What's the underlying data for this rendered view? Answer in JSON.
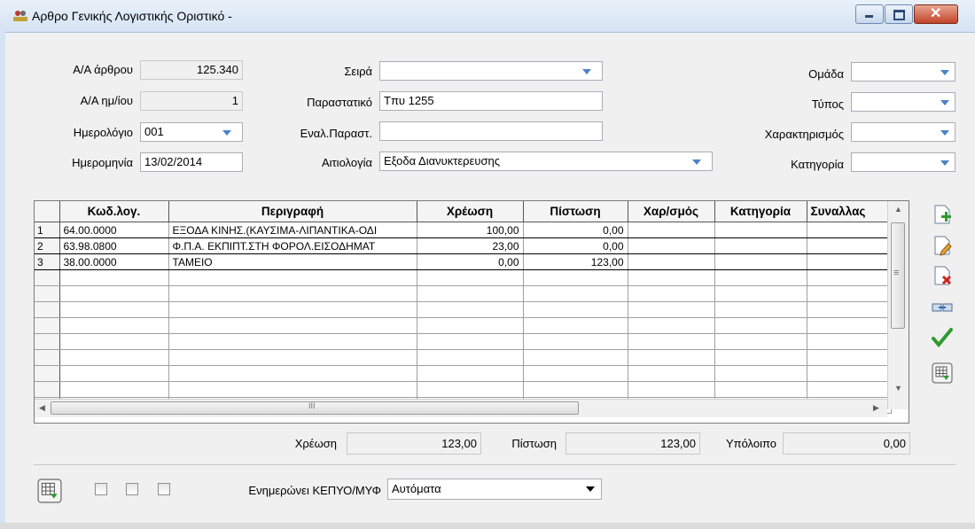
{
  "window": {
    "title": "Αρθρο Γενικής Λογιστικής Οριστικό -"
  },
  "header": {
    "aa_arthrou_label": "Α/Α άρθρου",
    "aa_arthrou_value": "125.340",
    "aa_hmeras_label": "Α/Α ημ/ίου",
    "aa_hmeras_value": "1",
    "journal_label": "Ημερολόγιο",
    "journal_value": "001",
    "date_label": "Ημερομηνία",
    "date_value": "13/02/2014",
    "series_label": "Σειρά",
    "series_value": "",
    "document_label": "Παραστατικό",
    "document_value": "Τπυ 1255",
    "alt_document_label": "Εναλ.Παραστ.",
    "alt_document_value": "",
    "reason_label": "Αιτιολογία",
    "reason_value": "Εξοδα Διανυκτερευσης",
    "group_label": "Ομάδα",
    "group_value": "",
    "type_label": "Τύπος",
    "type_value": "",
    "characterization_label": "Χαρακτηρισμός",
    "characterization_value": "",
    "category_label": "Κατηγορία",
    "category_value": ""
  },
  "grid": {
    "columns": [
      "Κωδ.λογ.",
      "Περιγραφή",
      "Χρέωση",
      "Πίστωση",
      "Χαρ/σμός",
      "Κατηγορία",
      "Συναλλας"
    ],
    "rows": [
      {
        "n": "1",
        "code": "64.00.0000",
        "desc": "ΕΞΟΔΑ ΚΙΝΗΣ.(ΚΑΥΣΙΜΑ-ΛΙΠΑΝΤΙΚΑ-ΟΔΙ",
        "debit": "100,00",
        "credit": "0,00"
      },
      {
        "n": "2",
        "code": "63.98.0800",
        "desc": "Φ.Π.Α. ΕΚΠΙΠΤ.ΣΤΗ ΦΟΡΟΛ.ΕΙΣΟΔΗΜΑΤ",
        "debit": "23,00",
        "credit": "0,00"
      },
      {
        "n": "3",
        "code": "38.00.0000",
        "desc": "ΤΑΜΕΙΟ",
        "debit": "0,00",
        "credit": "123,00"
      }
    ],
    "hscroll_glyph": "III",
    "vscroll_glyph": "≡"
  },
  "totals": {
    "debit_label": "Χρέωση",
    "debit_value": "123,00",
    "credit_label": "Πίστωση",
    "credit_value": "123,00",
    "balance_label": "Υπόλοιπο",
    "balance_value": "0,00"
  },
  "footer": {
    "update_label": "Ενημερώνει ΚΕΠΥΟ/ΜΥΦ",
    "update_value": "Αυτόματα"
  },
  "icons": {
    "add": "add-row-icon",
    "edit": "edit-row-icon",
    "delete": "delete-row-icon",
    "link": "link-icon",
    "check": "check-icon",
    "export": "grid-export-icon"
  },
  "colors": {
    "title_bg": "#d5e3f3",
    "accent_arrow": "#4b83c6",
    "close": "#c0442a"
  }
}
